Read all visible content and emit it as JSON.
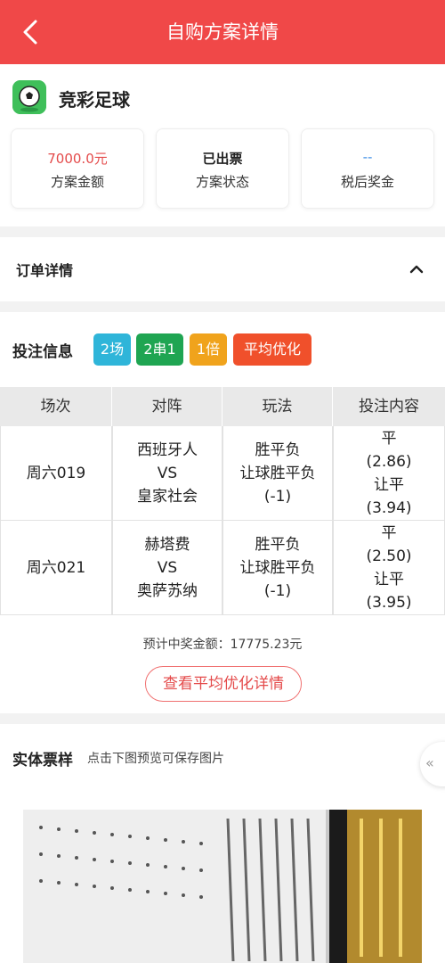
{
  "header": {
    "title": "自购方案详情",
    "back_icon": "chevron-left-icon"
  },
  "lottery": {
    "name": "竞彩足球",
    "logo_icon": "soccer-ball-icon",
    "cards": [
      {
        "value": "7000.0元",
        "label": "方案金额",
        "color": "#e44b4b"
      },
      {
        "value": "已出票",
        "label": "方案状态"
      },
      {
        "value": "--",
        "label": "税后奖金",
        "color": "#3e8ee6"
      }
    ]
  },
  "order": {
    "label": "订单详情",
    "icon": "chevron-up-icon"
  },
  "bet": {
    "label": "投注信息",
    "tags": [
      {
        "text": "2场",
        "color": "#2fb5d9"
      },
      {
        "text": "2串1",
        "color": "#1fa552"
      },
      {
        "text": "1倍",
        "color": "#f0a31c"
      },
      {
        "text": "平均优化",
        "color": "#f0502b"
      }
    ],
    "columns": [
      "场次",
      "对阵",
      "玩法",
      "投注内容"
    ],
    "rows": [
      {
        "match": "周六019",
        "home": "西班牙人",
        "vs": "VS",
        "away": "皇家社会",
        "play1": "胜平负",
        "play2": "让球胜平负",
        "play3": "(-1)",
        "pick1": "平",
        "odds1": "(2.86)",
        "pick2": "让平",
        "odds2": "(3.94)"
      },
      {
        "match": "周六021",
        "home": "赫塔费",
        "vs": "VS",
        "away": "奥萨苏纳",
        "play1": "胜平负",
        "play2": "让球胜平负",
        "play3": "(-1)",
        "pick1": "平",
        "odds1": "(2.50)",
        "pick2": "让平",
        "odds2": "(3.95)"
      }
    ],
    "prize_label": "预计中奖金额：",
    "prize_value": "17775.23元",
    "optimize_button": "查看平均优化详情"
  },
  "ticket": {
    "label": "实体票样",
    "hint": "点击下图预览可保存图片",
    "float_icon": "double-chevron-left-icon"
  }
}
